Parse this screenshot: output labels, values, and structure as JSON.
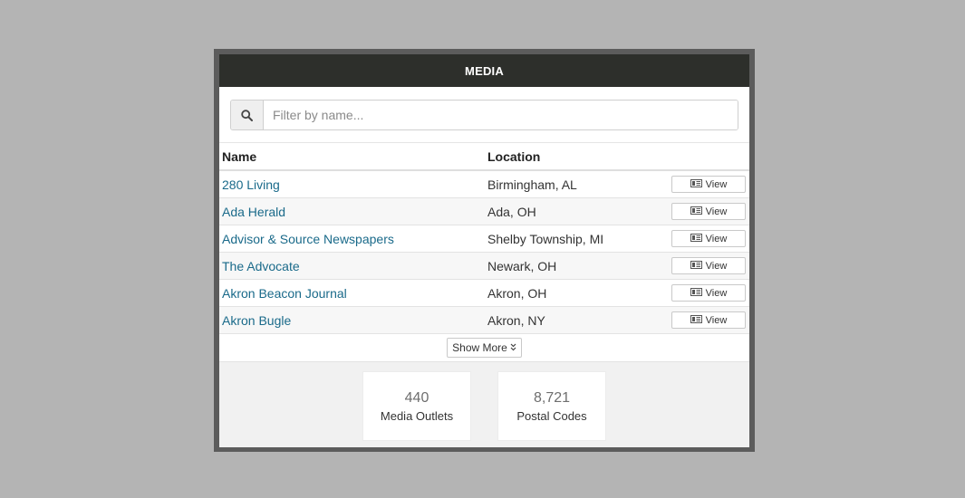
{
  "header": {
    "title": "MEDIA"
  },
  "search": {
    "placeholder": "Filter by name..."
  },
  "table": {
    "columns": [
      "Name",
      "Location",
      ""
    ],
    "rows": [
      {
        "name": "280 Living",
        "location": "Birmingham, AL",
        "action": "View"
      },
      {
        "name": "Ada Herald",
        "location": "Ada, OH",
        "action": "View"
      },
      {
        "name": "Advisor & Source Newspapers",
        "location": "Shelby Township, MI",
        "action": "View"
      },
      {
        "name": "The Advocate",
        "location": "Newark, OH",
        "action": "View"
      },
      {
        "name": "Akron Beacon Journal",
        "location": "Akron, OH",
        "action": "View"
      },
      {
        "name": "Akron Bugle",
        "location": "Akron, NY",
        "action": "View"
      }
    ]
  },
  "show_more": {
    "label": "Show More"
  },
  "stats": [
    {
      "value": "440",
      "label": "Media Outlets"
    },
    {
      "value": "8,721",
      "label": "Postal Codes"
    }
  ],
  "colors": {
    "header_bg": "#2d2f2b",
    "link": "#1a6a8a",
    "frame": "#5c5c5c",
    "page_bg": "#b4b4b4"
  },
  "icons": {
    "search": "search-icon",
    "view": "newspaper-icon",
    "show_more": "double-chevron-down-icon"
  }
}
